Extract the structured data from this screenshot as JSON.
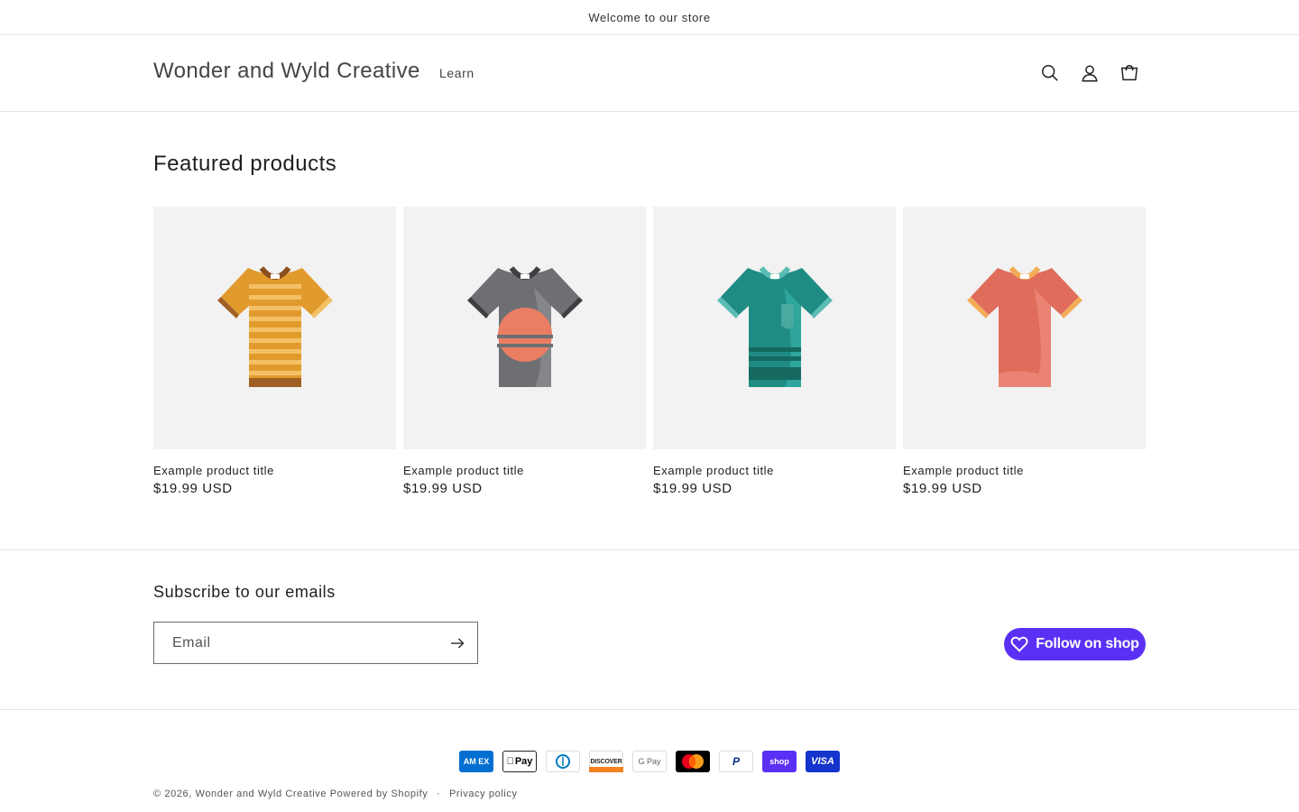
{
  "announcement": {
    "text": "Welcome to our store"
  },
  "header": {
    "logo": "Wonder and Wyld Creative",
    "nav": [
      {
        "label": "Learn"
      }
    ],
    "icons": [
      "search-icon",
      "account-icon",
      "cart-icon"
    ]
  },
  "featured": {
    "title": "Featured products",
    "products": [
      {
        "title": "Example product title",
        "price": "$19.99 USD",
        "image": "tshirt-orange-striped"
      },
      {
        "title": "Example product title",
        "price": "$19.99 USD",
        "image": "tshirt-gray-sunset"
      },
      {
        "title": "Example product title",
        "price": "$19.99 USD",
        "image": "tshirt-teal-pocket"
      },
      {
        "title": "Example product title",
        "price": "$19.99 USD",
        "image": "tshirt-coral"
      }
    ]
  },
  "subscribe": {
    "title": "Subscribe to our emails",
    "email_placeholder": "Email",
    "email_value": ""
  },
  "follow": {
    "label": "Follow on shop"
  },
  "payments": [
    {
      "name": "American Express",
      "label": "AM EX",
      "bg": "#016fd0",
      "fg": "#ffffff"
    },
    {
      "name": "Apple Pay",
      "label": "Pay",
      "bg": "#ffffff",
      "fg": "#000000"
    },
    {
      "name": "Diners Club",
      "label": "D",
      "bg": "#ffffff",
      "fg": "#0079be"
    },
    {
      "name": "Discover",
      "label": "DISCOVER",
      "bg": "#ffffff",
      "fg": "#231f20"
    },
    {
      "name": "Google Pay",
      "label": "G Pay",
      "bg": "#ffffff",
      "fg": "#5f6368"
    },
    {
      "name": "Mastercard",
      "label": "",
      "bg": "#000000",
      "fg": "#ffffff"
    },
    {
      "name": "PayPal",
      "label": "P",
      "bg": "#ffffff",
      "fg": "#003087"
    },
    {
      "name": "Shop Pay",
      "label": "shop",
      "bg": "#5a31f4",
      "fg": "#ffffff"
    },
    {
      "name": "Visa",
      "label": "VISA",
      "bg": "#1434cb",
      "fg": "#ffffff"
    }
  ],
  "footer": {
    "copyright": "© 2026,",
    "store_link": "Wonder and Wyld Creative",
    "powered": "Powered by Shopify",
    "separator": "·",
    "privacy": "Privacy policy"
  },
  "colors": {
    "accent_shop": "#5a31f4",
    "card_bg": "#f2f2f2",
    "border": "#e6e6e6"
  }
}
